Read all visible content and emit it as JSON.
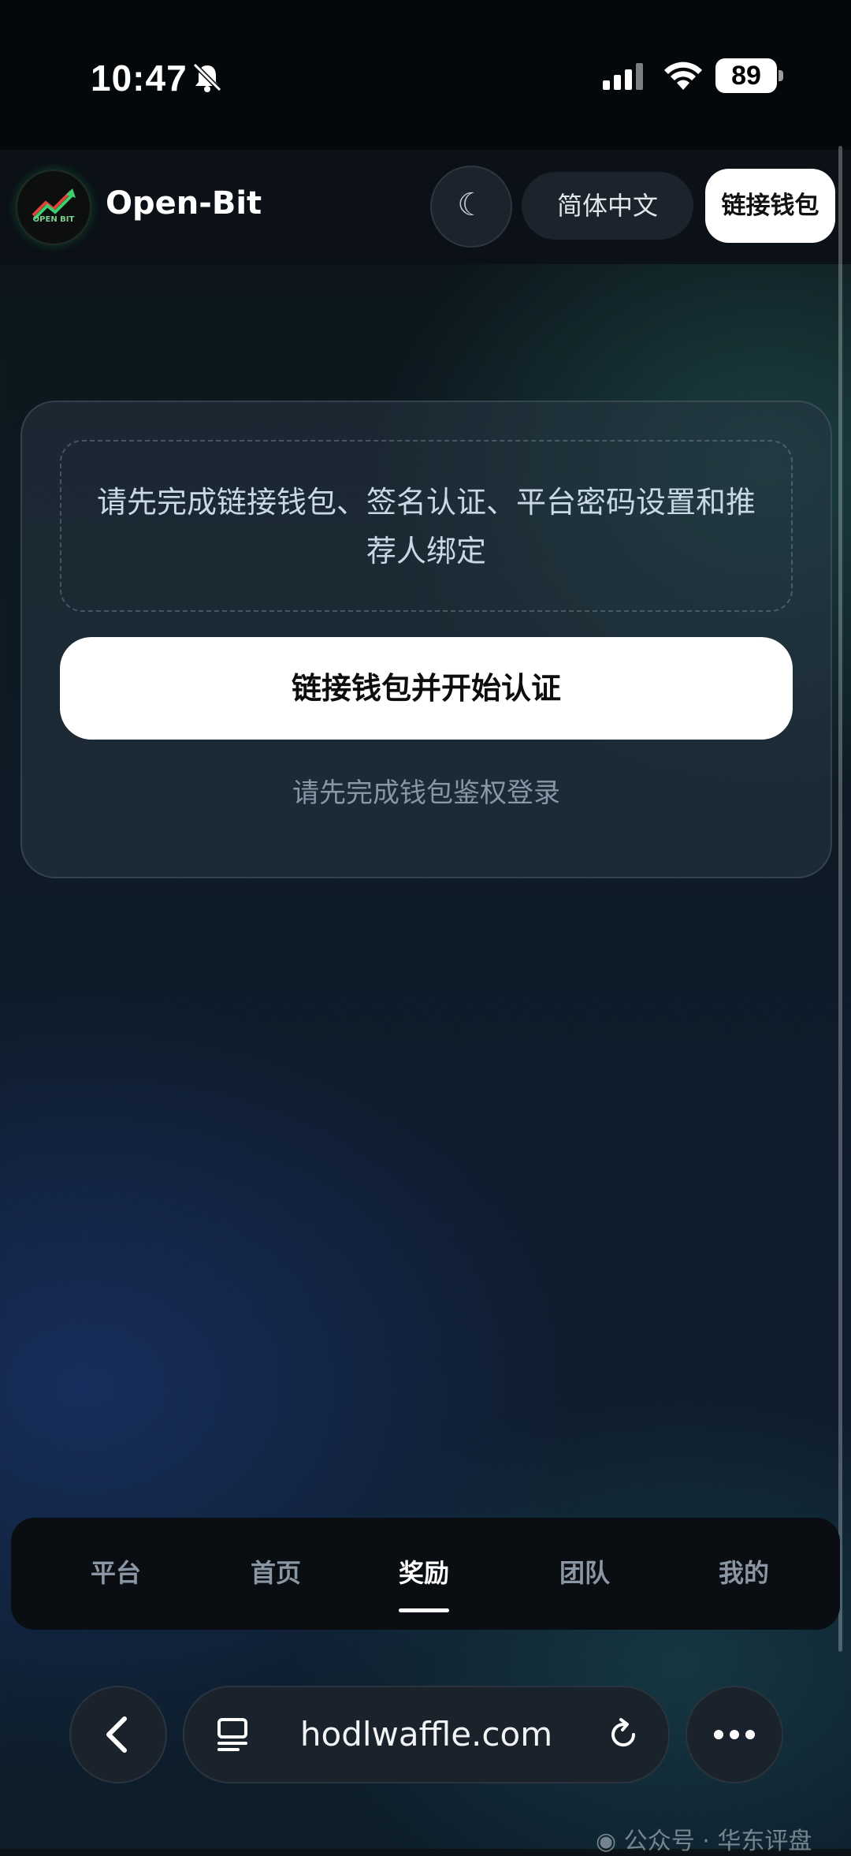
{
  "status_bar": {
    "time": "10:47",
    "battery": "89"
  },
  "header": {
    "brand": "Open-Bit",
    "logo_text": "OPEN BIT",
    "theme_icon": "☾",
    "language": "简体中文",
    "wallet_button": "链接钱包"
  },
  "card": {
    "notice": "请先完成链接钱包、签名认证、平台密码设置和推荐人绑定",
    "primary_button": "链接钱包并开始认证",
    "hint": "请先完成钱包鉴权登录"
  },
  "tabs": [
    {
      "label": "平台",
      "active": false
    },
    {
      "label": "首页",
      "active": false
    },
    {
      "label": "奖励",
      "active": true
    },
    {
      "label": "团队",
      "active": false
    },
    {
      "label": "我的",
      "active": false
    }
  ],
  "browser": {
    "url": "hodlwaffle.com"
  },
  "watermark": "公众号 · 华东评盘",
  "icons": [
    "bell-slash-icon",
    "signal-icon",
    "wifi-icon",
    "moon-icon",
    "back-chevron-icon",
    "tabs-list-icon",
    "reload-icon",
    "more-dots-icon",
    "wechat-icon"
  ]
}
